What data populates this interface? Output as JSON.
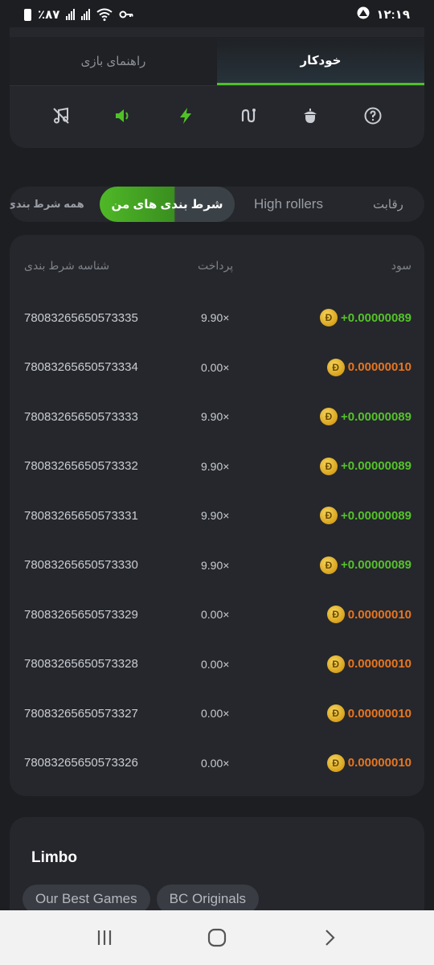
{
  "status_bar": {
    "battery": "٪۸۷",
    "time": "۱۲:۱۹"
  },
  "tabs": {
    "guide": "راهنمای بازی",
    "auto": "خودکار"
  },
  "icons": [
    "music-off-icon",
    "sound-on-icon",
    "lightning-icon",
    "route-icon",
    "acorn-icon",
    "help-icon"
  ],
  "filter": {
    "competition": "رقابت",
    "high_rollers": "High rollers",
    "my_bets": "شرط بندی های من",
    "all_bets": "همه شرط بندی"
  },
  "table": {
    "headers": {
      "profit": "سود",
      "payout": "پرداخت",
      "bet_id": "شناسه شرط بندی"
    },
    "rows": [
      {
        "id": "78083265650573335",
        "payout": "9.90×",
        "profit": "+0.00000089",
        "status": "win"
      },
      {
        "id": "78083265650573334",
        "payout": "0.00×",
        "profit": "0.00000010",
        "status": "loss"
      },
      {
        "id": "78083265650573333",
        "payout": "9.90×",
        "profit": "+0.00000089",
        "status": "win"
      },
      {
        "id": "78083265650573332",
        "payout": "9.90×",
        "profit": "+0.00000089",
        "status": "win"
      },
      {
        "id": "78083265650573331",
        "payout": "9.90×",
        "profit": "+0.00000089",
        "status": "win"
      },
      {
        "id": "78083265650573330",
        "payout": "9.90×",
        "profit": "+0.00000089",
        "status": "win"
      },
      {
        "id": "78083265650573329",
        "payout": "0.00×",
        "profit": "0.00000010",
        "status": "loss"
      },
      {
        "id": "78083265650573328",
        "payout": "0.00×",
        "profit": "0.00000010",
        "status": "loss"
      },
      {
        "id": "78083265650573327",
        "payout": "0.00×",
        "profit": "0.00000010",
        "status": "loss"
      },
      {
        "id": "78083265650573326",
        "payout": "0.00×",
        "profit": "0.00000010",
        "status": "loss"
      }
    ],
    "coin_symbol": "Đ"
  },
  "game": {
    "title": "Limbo",
    "chips": [
      "Our Best Games",
      "BC Originals"
    ]
  },
  "colors": {
    "accent_green": "#4fc226",
    "win": "#55c22a",
    "loss": "#e8751f",
    "background": "#1c1e22",
    "card": "#25272c"
  }
}
